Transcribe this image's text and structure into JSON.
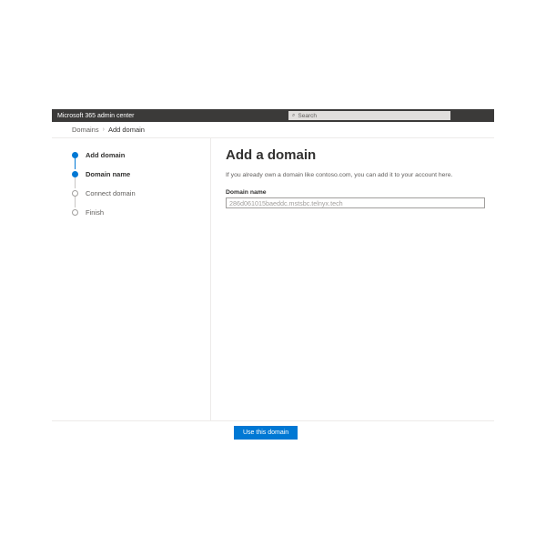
{
  "topbar": {
    "title": "Microsoft 365 admin center",
    "search_placeholder": "Search"
  },
  "breadcrumb": {
    "root": "Domains",
    "current": "Add domain"
  },
  "sidebar": {
    "steps": [
      {
        "label": "Add domain"
      },
      {
        "label": "Domain name"
      },
      {
        "label": "Connect domain"
      },
      {
        "label": "Finish"
      }
    ]
  },
  "main": {
    "heading": "Add a domain",
    "description": "If you already own a domain like contoso.com, you can add it to your account here.",
    "field_label": "Domain name",
    "field_value": "286d061015baeddc.mstsbc.telnyx.tech"
  },
  "footer": {
    "primary_button": "Use this domain"
  }
}
